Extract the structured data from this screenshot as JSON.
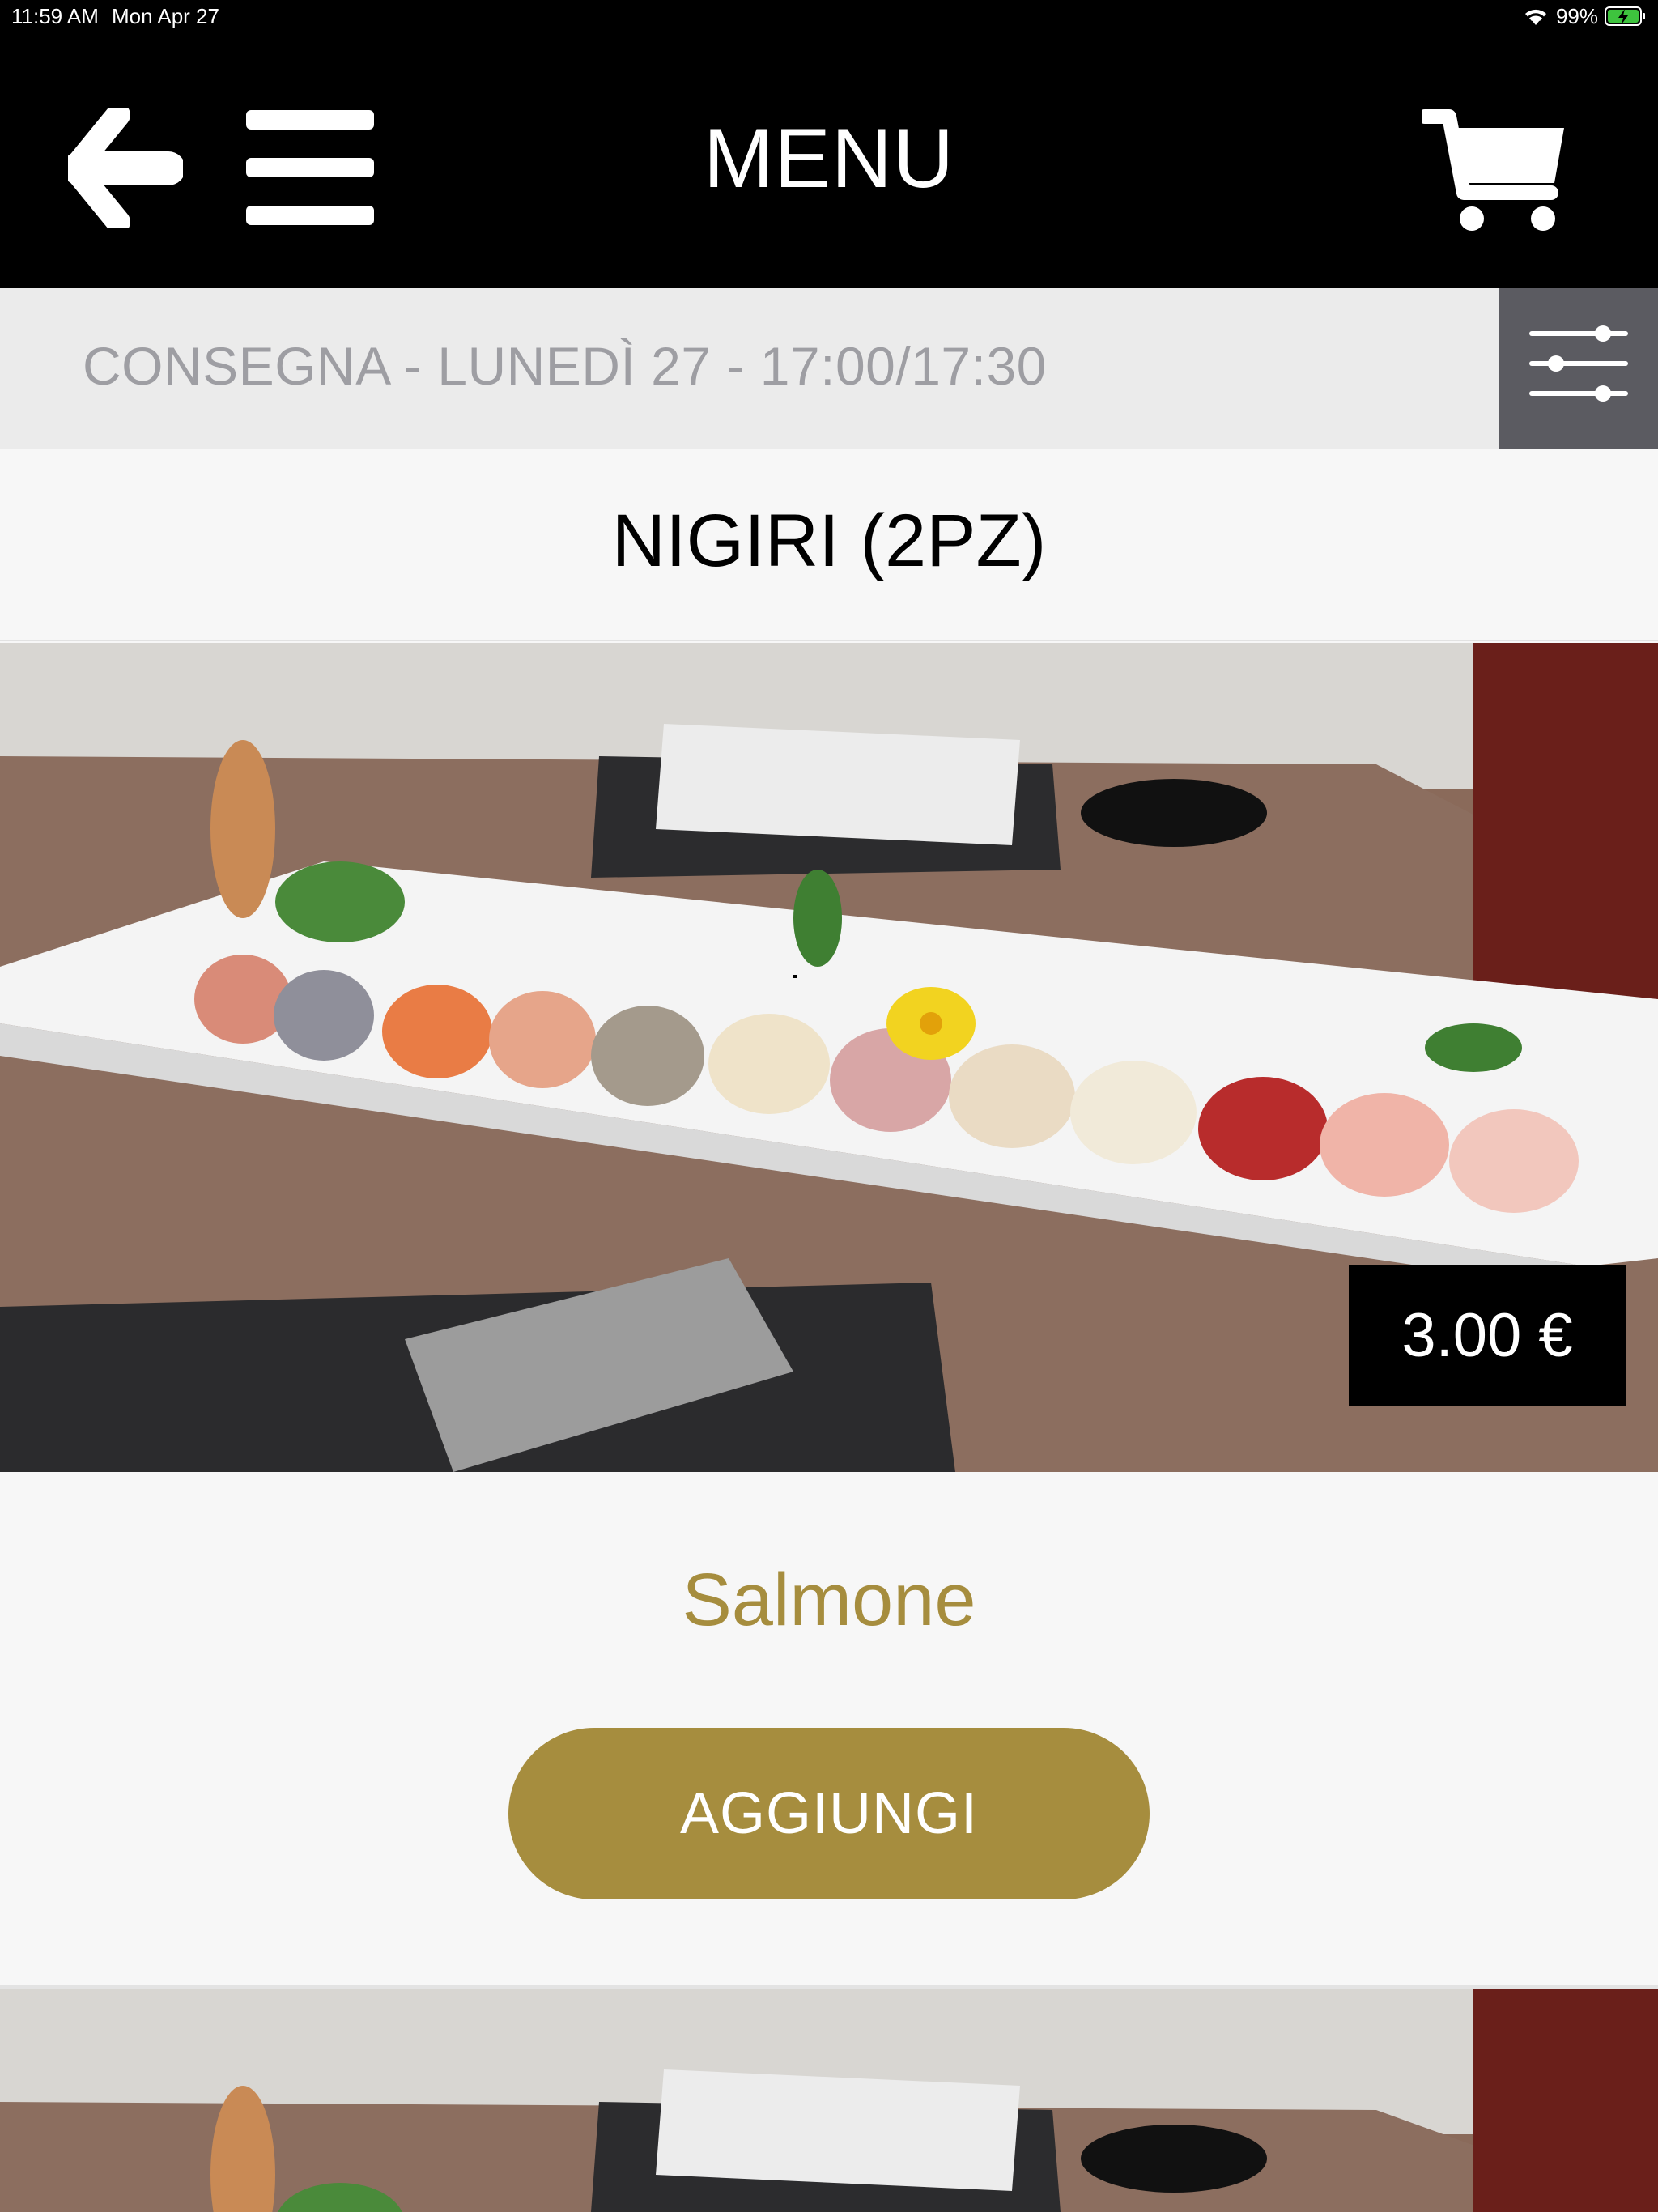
{
  "status_bar": {
    "time": "11:59 AM",
    "date": "Mon Apr 27",
    "battery": "99%",
    "icons": [
      "wifi-icon",
      "battery-charging-icon"
    ]
  },
  "navbar": {
    "title": "MENU",
    "icons": [
      "back-arrow-icon",
      "hamburger-menu-icon",
      "cart-icon"
    ]
  },
  "delivery": {
    "text": "CONSEGNA - LUNEDÌ 27 - 17:00/17:30",
    "filter_icon": "sliders-icon"
  },
  "category": {
    "title": "NIGIRI (2PZ)"
  },
  "products": [
    {
      "name": "Salmone",
      "price": "3.00 €",
      "add_label": "AGGIUNGI",
      "image": "sushi-platter-photo"
    }
  ],
  "colors": {
    "bar": "#000000",
    "delivery_bg": "#ebebeb",
    "filter_bg": "#5b5b61",
    "accent_gold": "#a68d3e",
    "page_bg": "#f7f7f7"
  }
}
